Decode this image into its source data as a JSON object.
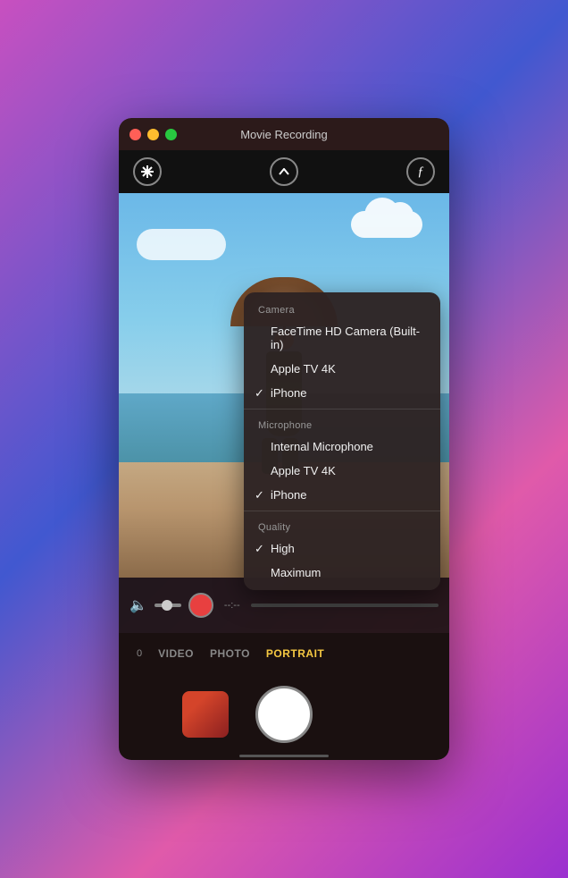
{
  "window": {
    "title": "Movie Recording",
    "buttons": {
      "close": "●",
      "minimize": "●",
      "maximize": "●"
    }
  },
  "top_controls": {
    "flash_icon": "⚡",
    "chevron_icon": "⌃",
    "filter_icon": "ƒ"
  },
  "recording": {
    "time": "--:--",
    "volume_label": "volume"
  },
  "modes": [
    {
      "label": "VIDEO",
      "active": false
    },
    {
      "label": "PHOTO",
      "active": false
    },
    {
      "label": "PORTRAIT",
      "active": true
    }
  ],
  "dropdown": {
    "camera_label": "Camera",
    "camera_items": [
      {
        "label": "FaceTime HD Camera (Built-in)",
        "checked": false
      },
      {
        "label": "Apple TV 4K",
        "checked": false
      },
      {
        "label": "iPhone",
        "checked": true
      }
    ],
    "microphone_label": "Microphone",
    "microphone_items": [
      {
        "label": "Internal Microphone",
        "checked": false
      },
      {
        "label": "Apple TV 4K",
        "checked": false
      },
      {
        "label": "iPhone",
        "checked": true
      }
    ],
    "quality_label": "Quality",
    "quality_items": [
      {
        "label": "High",
        "checked": true
      },
      {
        "label": "Maximum",
        "checked": false
      }
    ]
  },
  "scroll_indicator": "scroll-bar"
}
